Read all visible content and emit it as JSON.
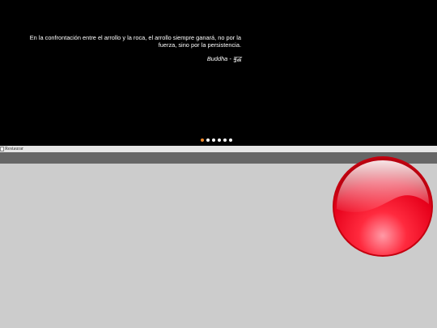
{
  "slider": {
    "quote": "En la confrontación entre el arrollo y la roca, el arrollo siempre ganará, no por la fuerza, sino por la persistencia.",
    "attribution": "Buddha - बुद्ध",
    "dots_total": 6,
    "active_dot": 1
  },
  "restore_image": {
    "alt": "Restaurar"
  },
  "colors": {
    "slider_bg": "#000000",
    "dot_active": "#f08a2c",
    "dot_inactive": "#ffffff",
    "bar": "#666666",
    "page_bg": "#cccccc",
    "ball": "#e8001a"
  },
  "icons": {
    "ball": "red-glossy-ball-icon",
    "broken_image": "broken-image-icon"
  }
}
